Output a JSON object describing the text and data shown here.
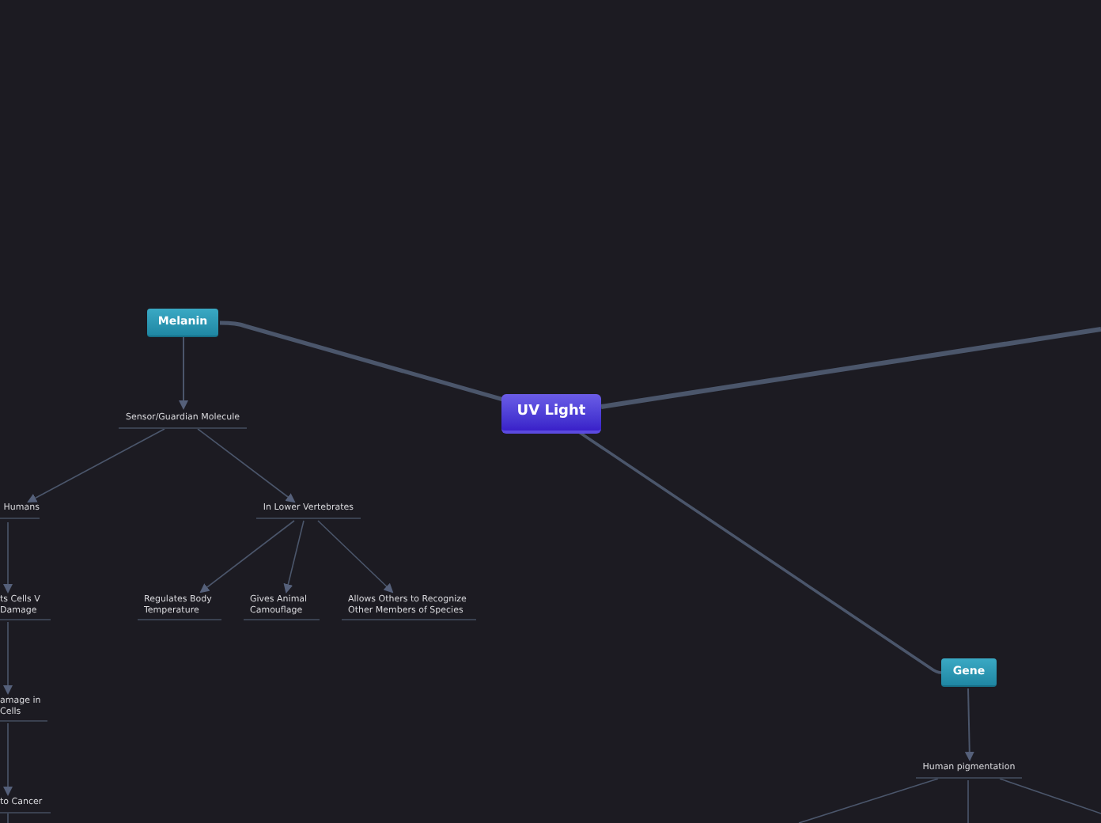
{
  "mind_map": {
    "label": "UV Light",
    "kind": "central",
    "children": [
      {
        "label": "Melanin",
        "kind": "main",
        "children": [
          {
            "label": "Sensor/Guardian Molecule",
            "kind": "topic",
            "children": [
              {
                "label": "Humans",
                "kind": "topic",
                "children": [
                  {
                    "label": "ts Cells V Damage",
                    "kind": "topic",
                    "children": [
                      {
                        "label": "amage in Cells",
                        "kind": "topic",
                        "children": [
                          {
                            "label": "to Cancer",
                            "kind": "topic"
                          }
                        ]
                      }
                    ]
                  }
                ]
              },
              {
                "label": "In Lower Vertebrates",
                "kind": "topic",
                "children": [
                  {
                    "label": "Regulates Body Temperature",
                    "kind": "topic"
                  },
                  {
                    "label": "Gives Animal Camouflage",
                    "kind": "topic"
                  },
                  {
                    "label": "Allows Others to Recognize Other Members of Species",
                    "kind": "topic"
                  }
                ]
              }
            ]
          }
        ]
      },
      {
        "label": "Gene",
        "kind": "main",
        "children": [
          {
            "label": "Human pigmentation",
            "kind": "topic"
          }
        ]
      }
    ]
  }
}
